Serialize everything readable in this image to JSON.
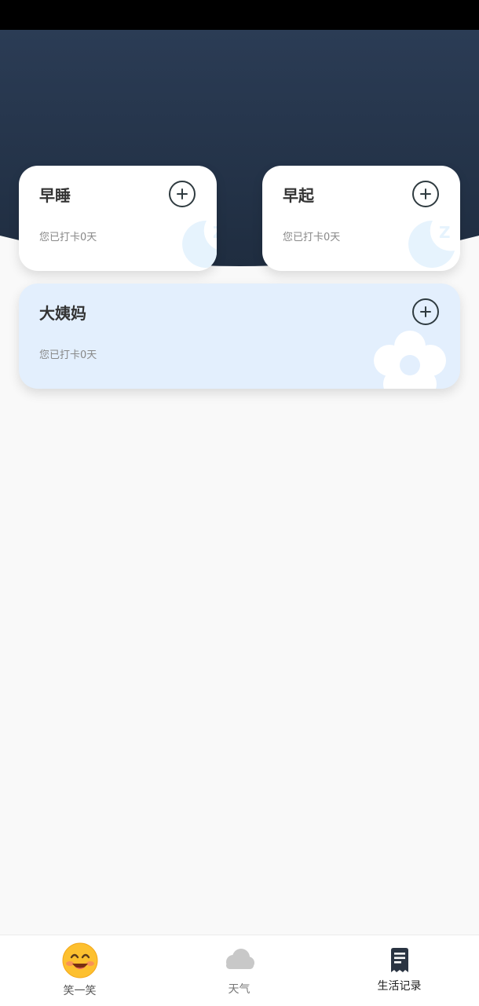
{
  "cards": [
    {
      "title": "早睡",
      "subtitle": "您已打卡0天",
      "icon": "moon-sleep-icon"
    },
    {
      "title": "早起",
      "subtitle": "您已打卡0天",
      "icon": "moon-sleep-icon"
    },
    {
      "title": "大姨妈",
      "subtitle": "您已打卡0天",
      "icon": "flower-icon"
    }
  ],
  "tabs": [
    {
      "label": "笑一笑",
      "icon": "smile-emoji-icon"
    },
    {
      "label": "天气",
      "icon": "cloud-icon"
    },
    {
      "label": "生活记录",
      "icon": "receipt-icon"
    }
  ],
  "colors": {
    "header_top": "#2b3c55",
    "header_bottom": "#1f2d40",
    "card_bg": "#ffffff",
    "period_card_bg": "#e3effd",
    "deco_light": "#e6f3fd",
    "tab_active": "#222222",
    "tab_inactive": "#888888"
  }
}
